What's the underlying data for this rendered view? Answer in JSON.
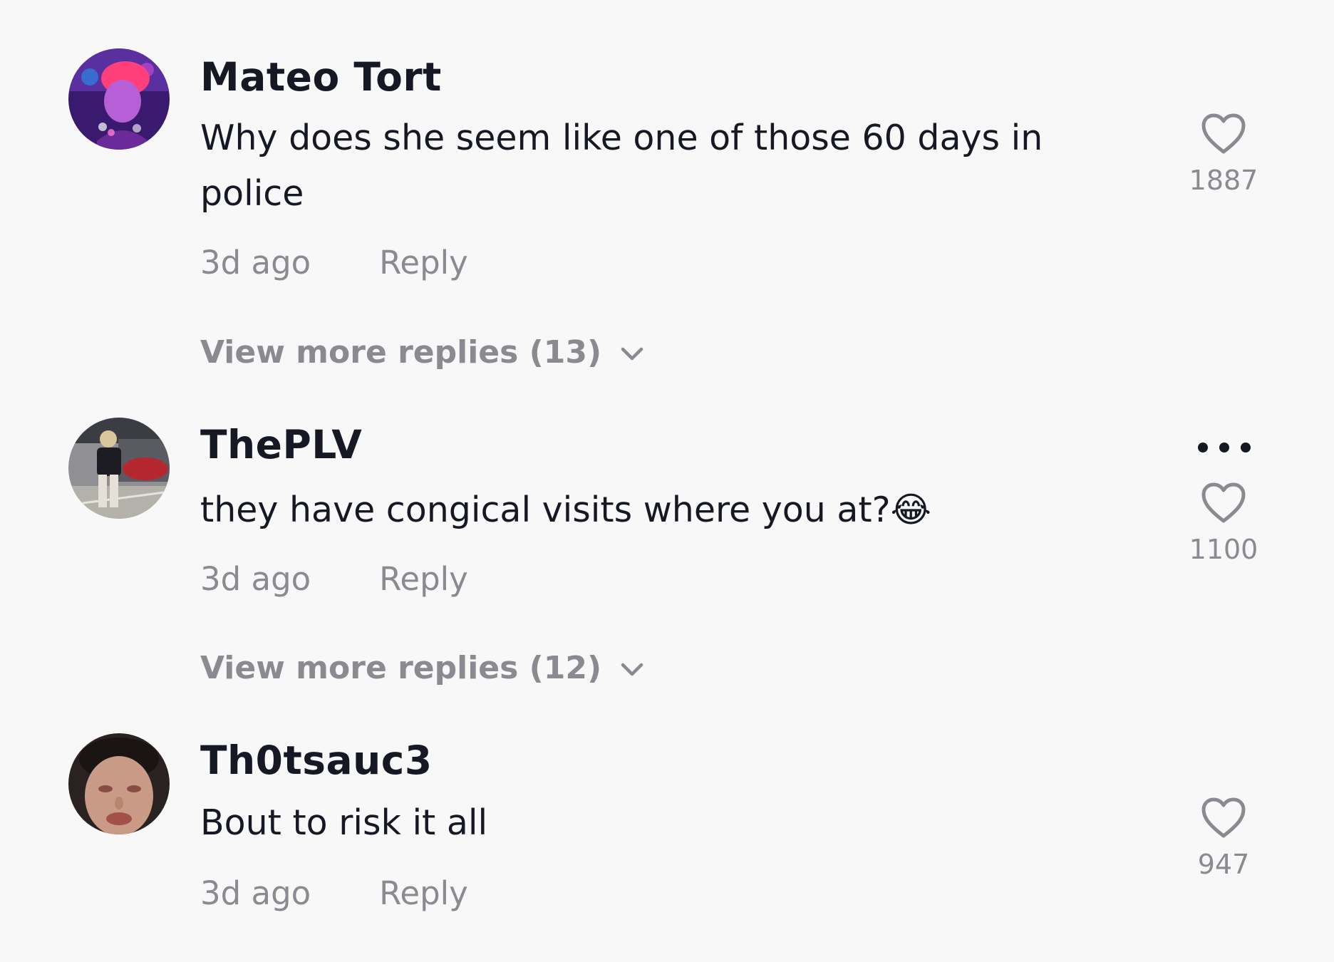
{
  "comments": [
    {
      "username": "Mateo Tort",
      "text": "Why does she seem like one of those 60 days in police",
      "time": "3d ago",
      "reply_label": "Reply",
      "like_count": "1887",
      "view_more": "View more replies (13)",
      "avatar_icon": "user-avatar-pink-hat"
    },
    {
      "username": "ThePLV",
      "text": "they have congical visits where you at?😂",
      "time": "3d ago",
      "reply_label": "Reply",
      "like_count": "1100",
      "view_more": "View more replies (12)",
      "avatar_icon": "user-avatar-parking-lot"
    },
    {
      "username": "Th0tsauc3",
      "text": "Bout to risk it all",
      "time": "3d ago",
      "reply_label": "Reply",
      "like_count": "947",
      "avatar_icon": "user-avatar-face"
    }
  ],
  "icons": {
    "like": "heart-outline-icon",
    "expand": "chevron-down-icon",
    "more": "more-options-icon"
  },
  "colors": {
    "background": "#f8f8f8",
    "primary_text": "#161823",
    "secondary_text": "#8a8b91"
  }
}
